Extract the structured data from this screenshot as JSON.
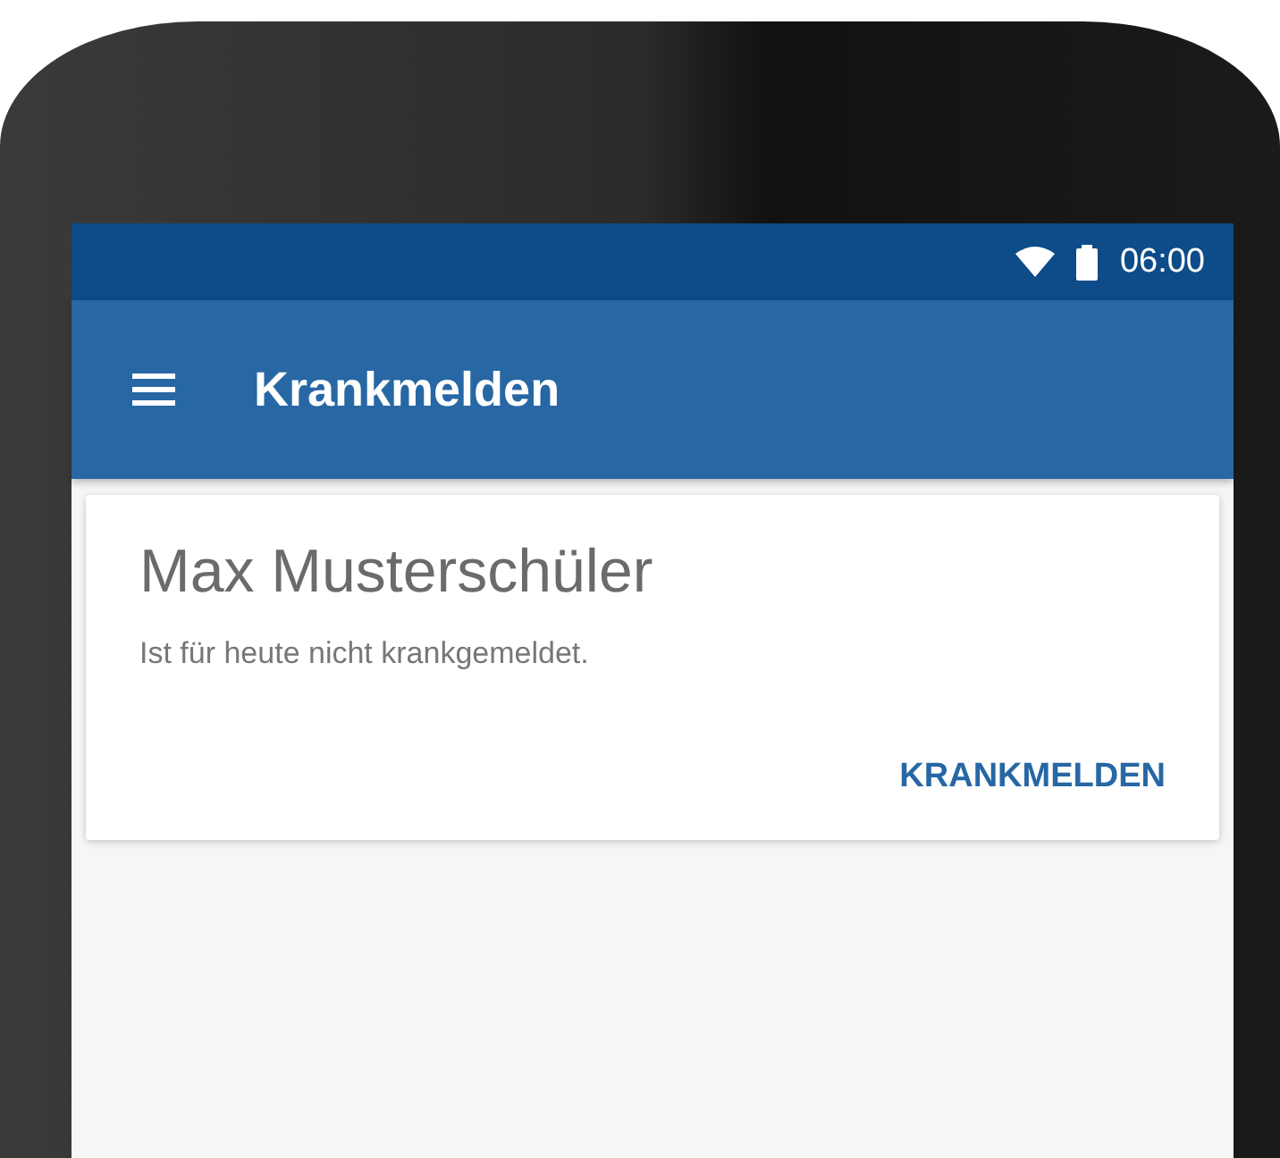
{
  "status_bar": {
    "time": "06:00"
  },
  "app_bar": {
    "title": "Krankmelden"
  },
  "card": {
    "name": "Max Musterschüler",
    "status": "Ist für heute nicht krankgemeldet.",
    "action": "KRANKMELDEN"
  }
}
